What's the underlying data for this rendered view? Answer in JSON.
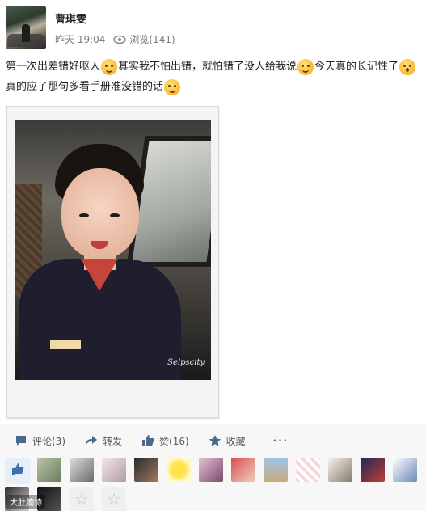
{
  "post": {
    "author": "曹琪雯",
    "time": "昨天 19:04",
    "views": "浏览(141)",
    "text_parts": [
      "第一次出差错好呕人",
      "其实我不怕出错，就怕错了没人给我说",
      "今天真的长记性了",
      "真的应了那句多看手册准没错的话"
    ],
    "emojis": [
      "angry-face-emoji",
      "unamused-face-emoji",
      "surprised-face-emoji",
      "annoyed-face-emoji"
    ],
    "photo_signature": "Selpscity."
  },
  "actions": {
    "comment": "评论(3)",
    "forward": "转发",
    "like": "赞(16)",
    "favorite": "收藏",
    "more": "···"
  },
  "likers": {
    "count_shown": 17
  },
  "watermark": "大肚腩诗",
  "colors": {
    "accent": "#4a6a8a",
    "like_bg": "#e6eef7",
    "bar_bg": "#f7f7f7"
  }
}
